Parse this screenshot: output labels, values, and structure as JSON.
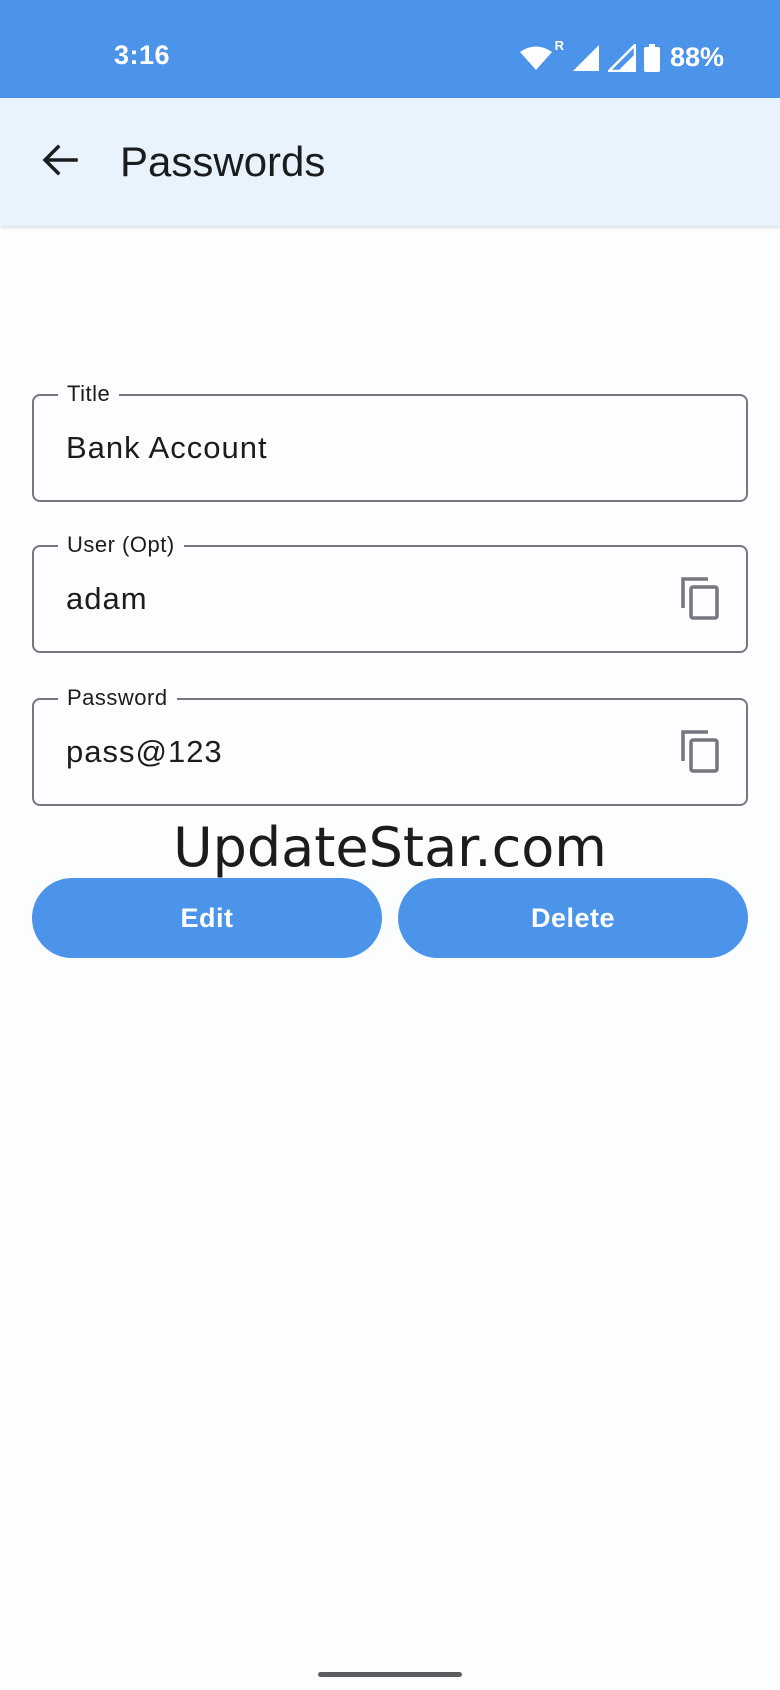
{
  "status_bar": {
    "time": "3:16",
    "roaming_indicator": "R",
    "battery_percent": "88%",
    "icons": [
      "wifi-icon",
      "signal-icon",
      "signal-icon",
      "battery-icon"
    ]
  },
  "app_bar": {
    "title": "Passwords",
    "back_icon": "arrow-back-icon"
  },
  "form": {
    "title_field": {
      "label": "Title",
      "value": "Bank Account"
    },
    "user_field": {
      "label": "User (Opt)",
      "value": "adam",
      "action_icon": "copy-icon"
    },
    "password_field": {
      "label": "Password",
      "value": "pass@123",
      "action_icon": "copy-icon"
    }
  },
  "watermark": "UpdateStar.com",
  "actions": {
    "edit_label": "Edit",
    "delete_label": "Delete"
  },
  "colors": {
    "primary": "#4c93ea",
    "app_bar_bg": "#e8f3fd",
    "background": "#fcfdff",
    "outline": "#74777f"
  }
}
